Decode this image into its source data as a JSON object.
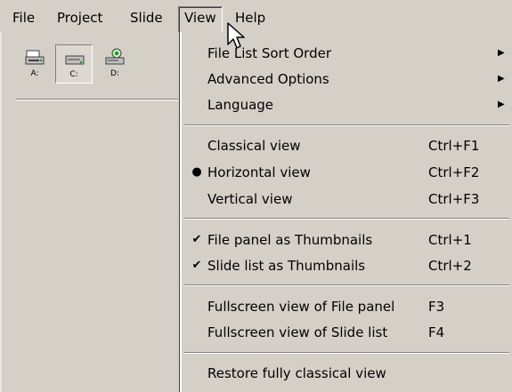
{
  "menubar": {
    "items": [
      {
        "label": "File"
      },
      {
        "label": "Project"
      },
      {
        "label": "Slide"
      },
      {
        "label": "View"
      },
      {
        "label": "Help"
      }
    ]
  },
  "toolbar": {
    "drives": [
      {
        "label": "A:",
        "icon": "floppy-drive-icon",
        "pressed": false
      },
      {
        "label": "C:",
        "icon": "hard-drive-icon",
        "pressed": true
      },
      {
        "label": "D:",
        "icon": "cd-drive-icon",
        "pressed": false
      }
    ]
  },
  "view_menu": {
    "items": [
      {
        "label": "File List Sort Order",
        "shortcut": "",
        "submenu": true,
        "mark": ""
      },
      {
        "label": "Advanced Options",
        "shortcut": "",
        "submenu": true,
        "mark": ""
      },
      {
        "label": "Language",
        "shortcut": "",
        "submenu": true,
        "mark": ""
      },
      {
        "label": "Classical view",
        "shortcut": "Ctrl+F1",
        "submenu": false,
        "mark": ""
      },
      {
        "label": "Horizontal view",
        "shortcut": "Ctrl+F2",
        "submenu": false,
        "mark": "●"
      },
      {
        "label": "Vertical view",
        "shortcut": "Ctrl+F3",
        "submenu": false,
        "mark": ""
      },
      {
        "label": "File panel as Thumbnails",
        "shortcut": "Ctrl+1",
        "submenu": false,
        "mark": "✔"
      },
      {
        "label": "Slide list as Thumbnails",
        "shortcut": "Ctrl+2",
        "submenu": false,
        "mark": "✔"
      },
      {
        "label": "Fullscreen view of File panel",
        "shortcut": "F3",
        "submenu": false,
        "mark": ""
      },
      {
        "label": "Fullscreen view of Slide list",
        "shortcut": "F4",
        "submenu": false,
        "mark": ""
      },
      {
        "label": "Restore fully classical view",
        "shortcut": "",
        "submenu": false,
        "mark": ""
      }
    ],
    "submenu_arrow": "▶"
  }
}
